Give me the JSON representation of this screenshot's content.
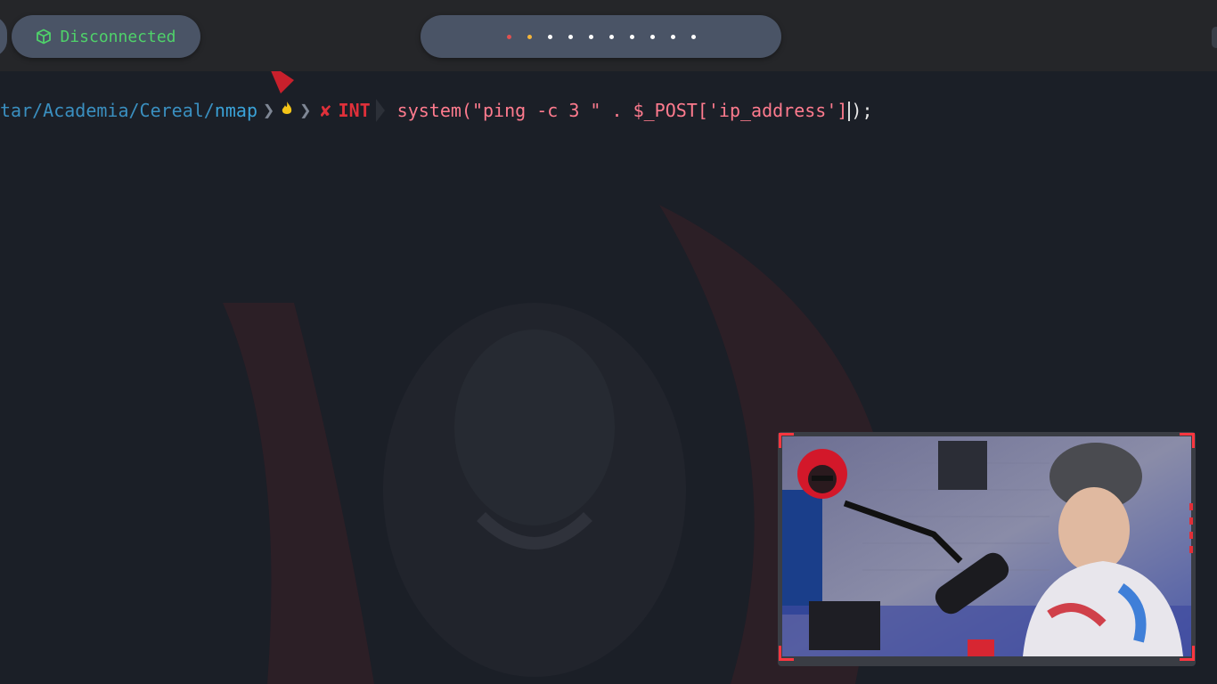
{
  "topbar": {
    "status": {
      "icon": "cube-icon",
      "label": "Disconnected",
      "color": "#4fd26a"
    },
    "workspaces": {
      "dots": [
        {
          "color": "#e05050"
        },
        {
          "color": "#f5b53a"
        },
        {
          "color": "#ffffff"
        },
        {
          "color": "#ffffff"
        },
        {
          "color": "#ffffff"
        },
        {
          "color": "#ffffff"
        },
        {
          "color": "#ffffff"
        },
        {
          "color": "#ffffff"
        },
        {
          "color": "#ffffff"
        },
        {
          "color": "#ffffff"
        }
      ]
    }
  },
  "terminal": {
    "prompt": {
      "path_prefix": "tar/Academia/Cereal/",
      "path_last": "nmap",
      "separator": "❯",
      "fire_icon": "fire-icon",
      "error_mark": "✘",
      "error_label": "INT"
    },
    "command": {
      "part1": "system(\"ping -c 3 \" . $_POST['ip_address']",
      "part2": ");"
    }
  },
  "webcam": {
    "avatar_icon": "hooded-avatar-icon",
    "accent_color": "#ff3640"
  }
}
